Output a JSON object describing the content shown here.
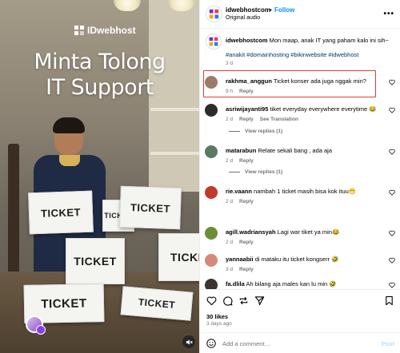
{
  "media": {
    "brand": "IDwebhost",
    "headline_line1": "Minta Tolong",
    "headline_line2": "IT Support",
    "ticket_text": "TICKET",
    "mute_icon": "speaker-muted-icon"
  },
  "header": {
    "username": "idwebhostcom",
    "separator": "•",
    "follow_label": "Follow",
    "audio_label": "Original audio",
    "more_icon": "more-horizontal-icon"
  },
  "caption": {
    "username": "idwebhostcom",
    "text": "Mon maap, anak IT yang paham kalo ini sih~",
    "hashtags": "#anakit #domainhosting #bikinwebsite #idwebhost",
    "age": "3 d"
  },
  "comments": [
    {
      "username": "rakhma_anggun",
      "text": "Ticket konser ada juga nggak min?",
      "age": "9 h",
      "reply": "Reply",
      "see_translation": "",
      "view_replies": "",
      "avatar_color": "#9b7a6a"
    },
    {
      "username": "asriwijayanti95",
      "text": "tiket everyday everywhere everytime 😂",
      "age": "2 d",
      "reply": "Reply",
      "see_translation": "See Translation",
      "view_replies": "View replies (1)",
      "avatar_color": "#2e2a28"
    },
    {
      "username": "matarabun",
      "text": "Relate sekali bang , ada aja",
      "age": "2 d",
      "reply": "Reply",
      "see_translation": "",
      "view_replies": "View replies (1)",
      "avatar_color": "#5a7a5f"
    },
    {
      "username": "rie.vaann",
      "text": "nambah 1 ticket masih bisa kok ituu😁",
      "age": "2 d",
      "reply": "Reply",
      "see_translation": "",
      "view_replies": "",
      "avatar_color": "#c0392b"
    },
    {
      "username": "agill.wadriansyah",
      "text": "Lagi war tiket ya min😂",
      "age": "2 d",
      "reply": "Reply",
      "see_translation": "",
      "view_replies": "",
      "avatar_color": "#6b8e3a"
    },
    {
      "username": "yannaabii",
      "text": "di mataku itu ticket kongserr 🤣",
      "age": "3 d",
      "reply": "Reply",
      "see_translation": "",
      "view_replies": "",
      "avatar_color": "#d48a7a"
    },
    {
      "username": "fa.dlila",
      "text": "Ah bilang aja males kan lu min 🤣",
      "age": "",
      "reply": "",
      "see_translation": "",
      "view_replies": "",
      "avatar_color": "#3a3330"
    }
  ],
  "actions": {
    "likes": "30 likes",
    "date": "3 days ago"
  },
  "composer": {
    "placeholder": "Add a comment…",
    "post_label": "Post"
  },
  "colors": {
    "link_blue": "#0095f6",
    "hashtag_blue": "#00376b",
    "highlight_red": "#e53935",
    "muted_gray": "#737373"
  }
}
